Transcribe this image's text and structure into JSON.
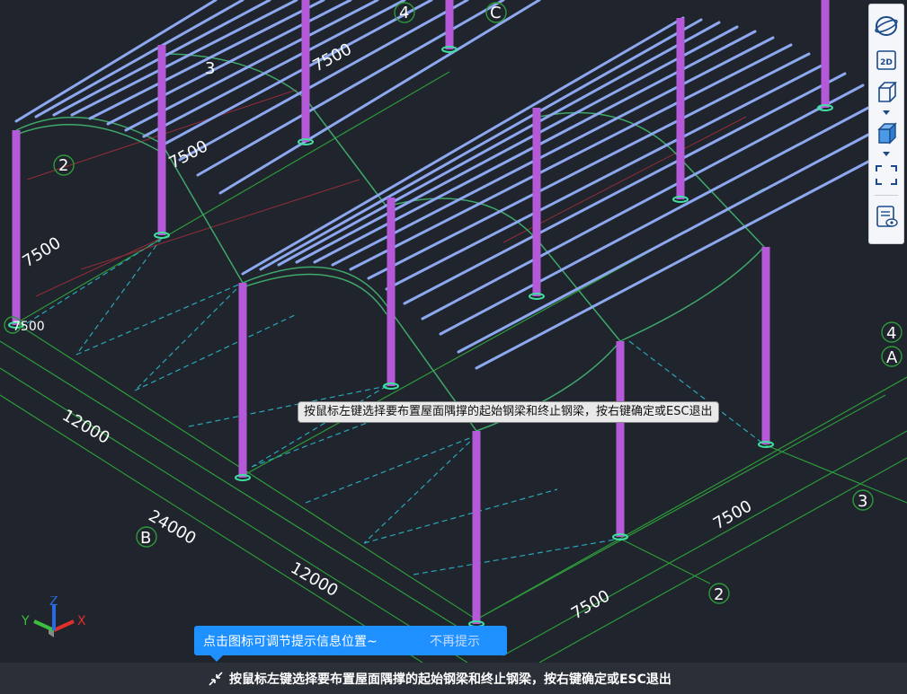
{
  "viewport": {
    "dimension_labels": [
      "4",
      "C",
      "3",
      "7500",
      "7500",
      "2",
      "7500",
      "7500",
      "12000",
      "24000",
      "B",
      "12000",
      "7500",
      "3",
      "7500",
      "2",
      "4",
      "A"
    ],
    "cursor_tooltip": "按鼠标左键选择要布置屋面隅撑的起始钢梁和终止钢梁，按右键确定或ESC退出"
  },
  "axis_triad": {
    "x": "X",
    "y": "Y",
    "z": "Z"
  },
  "toolbar": {
    "items": [
      "orbit-icon",
      "2d-view-icon",
      "3d-wireframe-icon",
      "3d-solid-icon",
      "fullscreen-icon",
      "layer-visibility-icon"
    ],
    "labels": {
      "view_2d": "2D"
    }
  },
  "hint": {
    "message": "点击图标可调节提示信息位置~",
    "dismiss": "不再提示"
  },
  "command_bar": {
    "prompt": "按鼠标左键选择要布置屋面隅撑的起始钢梁和终止钢梁，按右键确定或ESC退出"
  },
  "colors": {
    "background": "#1f242d",
    "column": "#b45ad9",
    "purlin": "#8ea8f0",
    "truss": "#3fa86a",
    "grid": "#2e9a3a",
    "hint": "#1e90ff"
  }
}
